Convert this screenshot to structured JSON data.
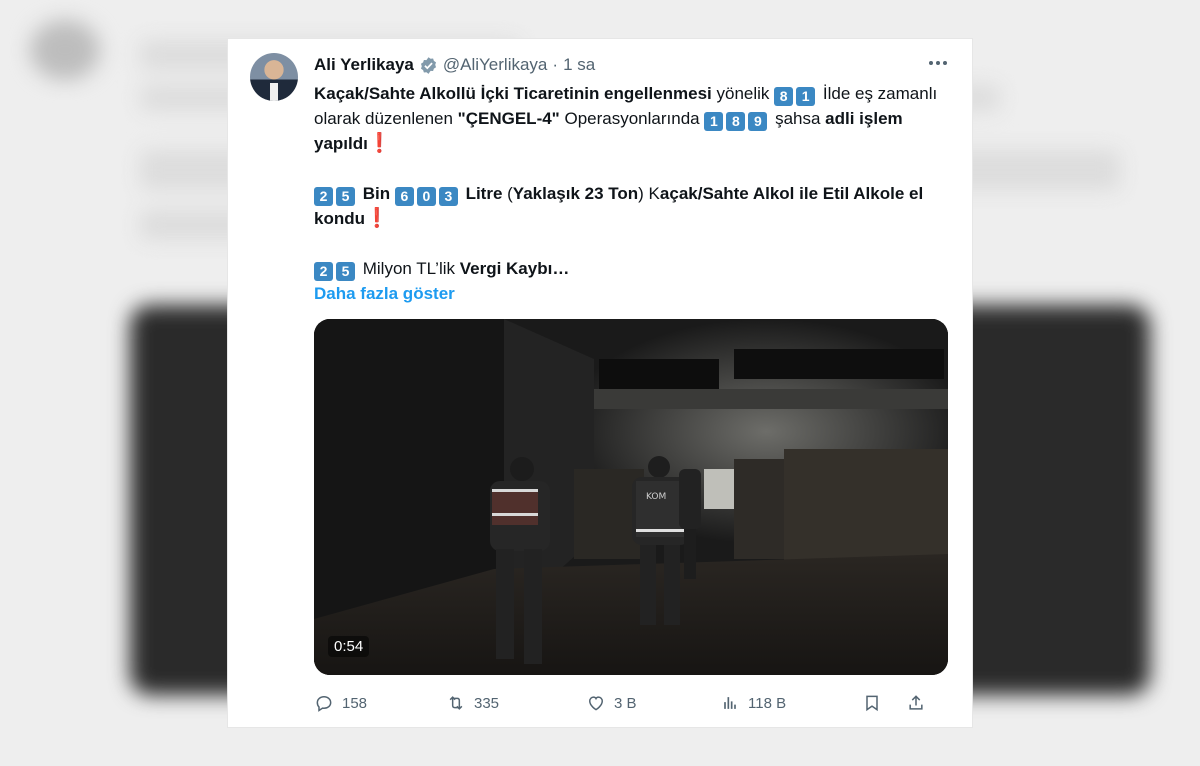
{
  "tweet": {
    "author_name": "Ali Yerlikaya",
    "handle": "@AliYerlikaya",
    "separator": "·",
    "time": "1 sa",
    "p1": {
      "bold1": "Kaçak/Sahte Alkollü İçki Ticaretinin engellenmesi",
      "t1": " yönelik ",
      "k1": "8",
      "k2": "1",
      "t2": " İlde eş zamanlı olarak düzenlenen ",
      "bold2": "\"ÇENGEL-4\"",
      "t3": " Operasyonlarında ",
      "k3": "1",
      "k4": "8",
      "k5": "9",
      "t4": " şahsa ",
      "bold3": "adli işlem yapıldı",
      "excl": "❗"
    },
    "p2": {
      "k1": "2",
      "k2": "5",
      "bold1": " Bin ",
      "k3": "6",
      "k4": "0",
      "k5": "3",
      "bold2": " Litre",
      "t1": " (",
      "bold3": "Yaklaşık 23 Ton",
      "t2": ") K",
      "bold4": "açak/Sahte Alkol ile Etil Alkole el kondu",
      "excl": "❗"
    },
    "p3": {
      "k1": "2",
      "k2": "5",
      "t1": " Milyon TL’lik ",
      "bold1": "Vergi Kaybı…"
    },
    "show_more": "Daha fazla göster",
    "video": {
      "duration": "0:54",
      "vest_text": "KOM"
    },
    "actions": {
      "replies": "158",
      "retweets": "335",
      "likes": "3 B",
      "views": "118 B"
    }
  },
  "colors": {
    "accent": "#1d9bf0",
    "keycap": "#3b88c3",
    "text": "#0f1419",
    "muted": "#536471",
    "exclamation": "#e53935"
  },
  "icons": [
    "verified-badge-icon",
    "more-icon",
    "reply-icon",
    "retweet-icon",
    "like-icon",
    "views-icon",
    "bookmark-icon",
    "share-icon"
  ]
}
